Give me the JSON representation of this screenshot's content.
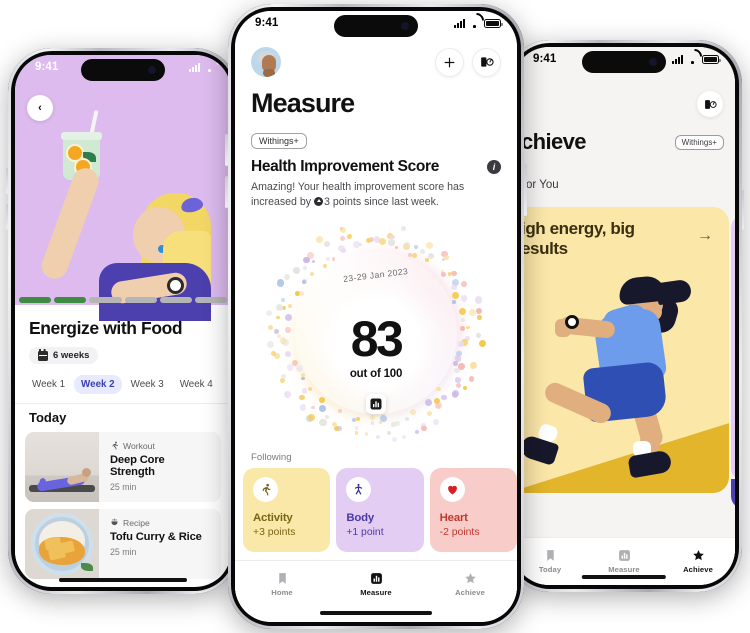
{
  "scene": {
    "background": "#ffffff",
    "device_count": 3
  },
  "left_phone": {
    "status": {
      "time": "9:41",
      "signal": "signal-bars-icon",
      "wifi": "wifi-icon"
    },
    "back_button": "‹",
    "hero": {
      "background": "#ddbbee",
      "illustration": "woman-holding-drink"
    },
    "progress": {
      "total_segments": 6,
      "completed_segments": 2,
      "done_color": "#3f8b43",
      "todo_color": "#b5b5b5"
    },
    "title": "Energize with Food",
    "duration_chip": {
      "icon": "calendar-icon",
      "label": "6 weeks"
    },
    "weeks": [
      {
        "label": "Week 1",
        "selected": false
      },
      {
        "label": "Week 2",
        "selected": true
      },
      {
        "label": "Week 3",
        "selected": false
      },
      {
        "label": "Week 4",
        "selected": false
      }
    ],
    "section_title": "Today",
    "items": [
      {
        "kind": "Workout",
        "kind_icon": "running-icon",
        "name": "Deep Core Strength",
        "duration": "25 min",
        "thumb": "plank-exercise-photo"
      },
      {
        "kind": "Recipe",
        "kind_icon": "pot-icon",
        "name": "Tofu Curry & Rice",
        "duration": "25 min",
        "thumb": "curry-plate-photo"
      }
    ]
  },
  "center_phone": {
    "status": {
      "time": "9:41",
      "signal": "signal-bars-icon",
      "wifi": "wifi-icon",
      "battery": "battery-icon"
    },
    "avatar": "user-avatar",
    "actions": [
      {
        "name": "add-button",
        "glyph": "+"
      },
      {
        "name": "scale-device-button",
        "glyph": "scale-icon"
      }
    ],
    "page_title": "Measure",
    "premium_badge": "Withings+",
    "card": {
      "heading": "Health Improvement Score",
      "info_icon": "info-icon",
      "description_before": "Amazing! Your health improvement score has increased by ",
      "inline_icon": "up-arrow-badge-icon",
      "description_after": "3 points since last week."
    },
    "score_ring": {
      "date_range": "23-29 Jan 2023",
      "score": "83",
      "out_of": "out of 100",
      "chart_button": "bar-chart-icon",
      "dot_colors": [
        "#f6c94e",
        "#c9b5e6",
        "#f6b8b0",
        "#a9c4e8",
        "#e4e2dd",
        "#f7dfa0",
        "#e8dcf2"
      ]
    },
    "following_label": "Following",
    "following_cards": [
      {
        "name": "Activity",
        "points": "+3 points",
        "icon": "running-icon",
        "bg": "#fae8a9",
        "fg": "#7a6517"
      },
      {
        "name": "Body",
        "points": "+1 point",
        "icon": "body-icon",
        "bg": "#e3cdf3",
        "fg": "#4a3aa8"
      },
      {
        "name": "Heart",
        "points": "-2 points",
        "icon": "heart-icon",
        "bg": "#f8ccc8",
        "fg": "#c0392f"
      }
    ],
    "tabs": [
      {
        "label": "Home",
        "icon": "home-bookmark-icon",
        "active": false
      },
      {
        "label": "Measure",
        "icon": "bar-chart-icon",
        "active": true
      },
      {
        "label": "Achieve",
        "icon": "star-icon",
        "active": false
      }
    ]
  },
  "right_phone": {
    "status": {
      "time": "9:41",
      "signal": "signal-bars-icon",
      "wifi": "wifi-icon",
      "battery": "battery-icon"
    },
    "scale_button": "scale-icon",
    "page_title": "chieve",
    "premium_badge": "Withings+",
    "tab_label": "For You",
    "card": {
      "title": "igh energy, big\nesults",
      "arrow": "→",
      "bg": "#fbe7a8",
      "illustration": "running-woman"
    },
    "tabs": [
      {
        "label": "Today",
        "icon": "home-bookmark-icon",
        "active": false
      },
      {
        "label": "Measure",
        "icon": "bar-chart-icon",
        "active": false
      },
      {
        "label": "Achieve",
        "icon": "star-icon",
        "active": true
      }
    ]
  }
}
